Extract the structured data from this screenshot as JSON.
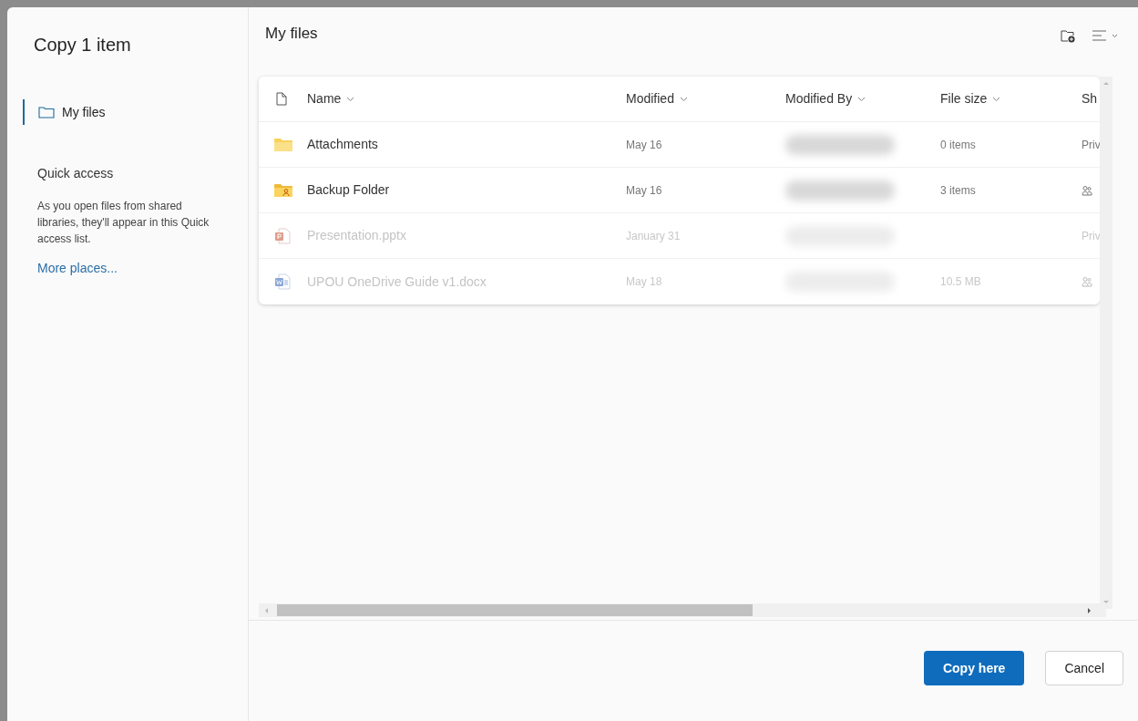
{
  "dialog": {
    "title": "Copy 1 item"
  },
  "sidebar": {
    "items": [
      {
        "label": "My files",
        "selected": true
      }
    ],
    "quick_access": {
      "heading": "Quick access",
      "description": "As you open files from shared libraries, they'll appear in this Quick access list.",
      "link": "More places..."
    }
  },
  "location": {
    "title": "My files"
  },
  "table": {
    "columns": [
      {
        "label": "Name"
      },
      {
        "label": "Modified"
      },
      {
        "label": "Modified By"
      },
      {
        "label": "File size"
      },
      {
        "label": "Sh"
      }
    ],
    "rows": [
      {
        "kind": "folder",
        "name": "Attachments",
        "modified": "May 16",
        "file_size": "0 items",
        "sharing": {
          "kind": "text",
          "text": "Priv"
        },
        "disabled": false
      },
      {
        "kind": "shared-folder",
        "name": "Backup Folder",
        "modified": "May 16",
        "file_size": "3 items",
        "sharing": {
          "kind": "people"
        },
        "disabled": false
      },
      {
        "kind": "pptx",
        "name": "Presentation.pptx",
        "modified": "January 31",
        "sharing": {
          "kind": "text",
          "text": "Priv"
        },
        "disabled": true
      },
      {
        "kind": "docx",
        "name": "UPOU OneDrive Guide v1.docx",
        "modified": "May 18",
        "file_size": "10.5 MB",
        "sharing": {
          "kind": "people"
        },
        "disabled": true
      }
    ]
  },
  "buttons": [
    {
      "kind": "primary",
      "label": "Copy here"
    },
    {
      "kind": "secondary",
      "label": "Cancel"
    }
  ]
}
